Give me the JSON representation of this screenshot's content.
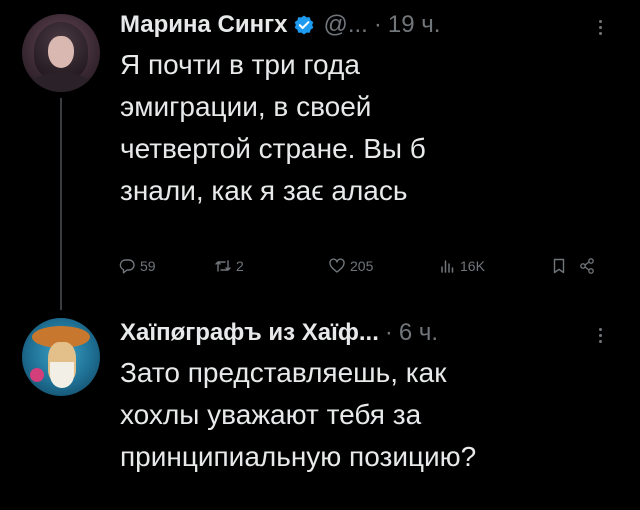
{
  "posts": [
    {
      "author_name": "Марина Сингх",
      "handle": "@...",
      "separator": "·",
      "time": "19 ч.",
      "text": "Я почти в три года\nэмиграции, в своей\nчетвертой стране. Вы б\nзнали, как я заϵ   алась",
      "stats": {
        "replies": "59",
        "reposts": "2",
        "likes": "205",
        "views": "16K"
      }
    },
    {
      "author_name": "Хаїпøграфъ из Хаїф...",
      "separator": "·",
      "time": "6 ч.",
      "text": "Зато представляешь, как\nхохлы уважают тебя за\nпринципиальную позицию?"
    }
  ],
  "colors": {
    "background": "#000000",
    "text_primary": "#e7e9ea",
    "text_secondary": "#71767b",
    "verified_badge": "#1d9bf0"
  },
  "icons": [
    "verified-badge-icon",
    "more-icon",
    "reply-icon",
    "repost-icon",
    "like-icon",
    "views-icon",
    "bookmark-icon",
    "share-icon"
  ]
}
